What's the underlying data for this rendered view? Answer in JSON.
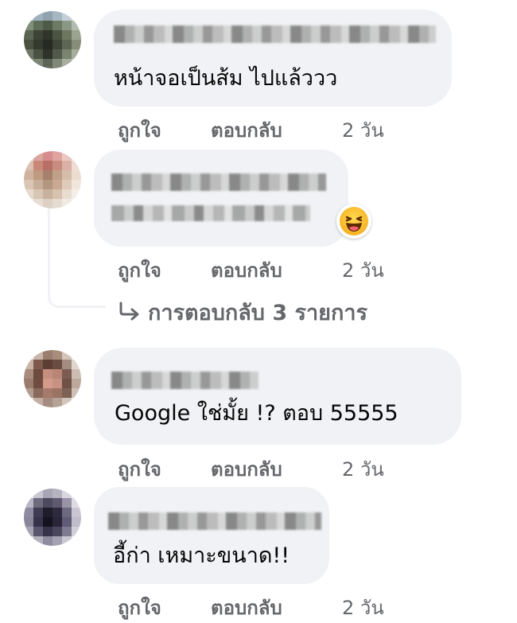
{
  "comments": [
    {
      "text": "หน้าจอเป็นส้ม ไปแล้ววว",
      "actions": {
        "like": "ถูกใจ",
        "reply": "ตอบกลับ",
        "time": "2 วัน"
      }
    },
    {
      "text": "",
      "reaction": "laughing-emoji",
      "actions": {
        "like": "ถูกใจ",
        "reply": "ตอบกลับ",
        "time": "2 วัน"
      },
      "replies_link": "การตอบกลับ 3 รายการ"
    },
    {
      "text": "Google ใช่มั้ย !? ตอบ 55555",
      "actions": {
        "like": "ถูกใจ",
        "reply": "ตอบกลับ",
        "time": "2 วัน"
      }
    },
    {
      "text": "อี้ก่า เหมาะขนาด!!",
      "actions": {
        "like": "ถูกใจ",
        "reply": "ตอบกลับ",
        "time": "2 วัน"
      }
    }
  ],
  "colors": {
    "bubble": "#f0f2f5",
    "meta": "#65676b",
    "text": "#050505"
  }
}
